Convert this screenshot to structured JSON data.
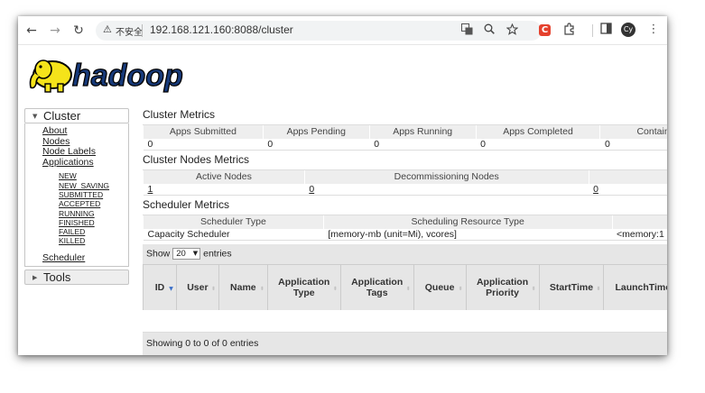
{
  "browser": {
    "back": "←",
    "forward": "→",
    "reload": "↻",
    "warning": "⚠",
    "insecure_label": "不安全",
    "url": "192.168.121.160:8088/cluster",
    "avatar_initials": "Cy",
    "menu": "⋮"
  },
  "logo": {
    "text": "hadoop"
  },
  "sidebar": {
    "cluster": {
      "label": "Cluster",
      "links": [
        "About",
        "Nodes",
        "Node Labels",
        "Applications"
      ],
      "app_states": [
        "NEW",
        "NEW_SAVING",
        "SUBMITTED",
        "ACCEPTED",
        "RUNNING",
        "FINISHED",
        "FAILED",
        "KILLED"
      ],
      "scheduler": "Scheduler"
    },
    "tools": {
      "label": "Tools"
    }
  },
  "cluster_metrics": {
    "title": "Cluster Metrics",
    "headers": [
      "Apps Submitted",
      "Apps Pending",
      "Apps Running",
      "Apps Completed",
      "Containe"
    ],
    "values": [
      "0",
      "0",
      "0",
      "0",
      "0"
    ]
  },
  "nodes_metrics": {
    "title": "Cluster Nodes Metrics",
    "headers": [
      "Active Nodes",
      "Decommissioning Nodes",
      ""
    ],
    "values": [
      "1",
      "0",
      "0"
    ]
  },
  "scheduler_metrics": {
    "title": "Scheduler Metrics",
    "headers": [
      "Scheduler Type",
      "Scheduling Resource Type",
      ""
    ],
    "values": [
      "Capacity Scheduler",
      "[memory-mb (unit=Mi), vcores]",
      "<memory:1"
    ]
  },
  "apps": {
    "show_label": "Show",
    "page_size": "20",
    "entries_label": "entries",
    "columns": [
      "ID",
      "User",
      "Name",
      "Application Type",
      "Application Tags",
      "Queue",
      "Application Priority",
      "StartTime",
      "LaunchTime"
    ],
    "footer": "Showing 0 to 0 of 0 entries"
  }
}
